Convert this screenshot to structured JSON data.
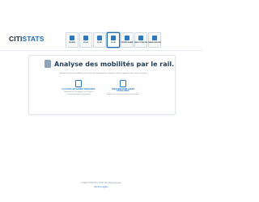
{
  "header": {
    "logo_part1": "CITI",
    "logo_part2": "STATS"
  },
  "nav": [
    {
      "label": "Crises"
    },
    {
      "label": "Ville"
    },
    {
      "label": "Flux"
    },
    {
      "label": "Flux"
    },
    {
      "label": "Ferroviaire"
    },
    {
      "label": "Géolocation"
    },
    {
      "label": "Ressources"
    }
  ],
  "main": {
    "title": "Analyse des mobilités par le rail.",
    "subtitle": "Analyse des flux de mobilités par le rail et des fréquentations voyageurs et des voyageurs des gares françaises.",
    "choices": [
      {
        "title": "Flux sur les gares françaises",
        "desc": "Analyse des flux de voyageurs sur les gares françaises par origine et destination."
      },
      {
        "title": "Fréquentation gares françaises",
        "desc": "Évolution de la fréquentation des gares françaises."
      }
    ]
  },
  "footer": {
    "copyright": "© 2023 CITISTATS | CITIS. Tous droits réservés.",
    "link": "Mentions légales"
  }
}
